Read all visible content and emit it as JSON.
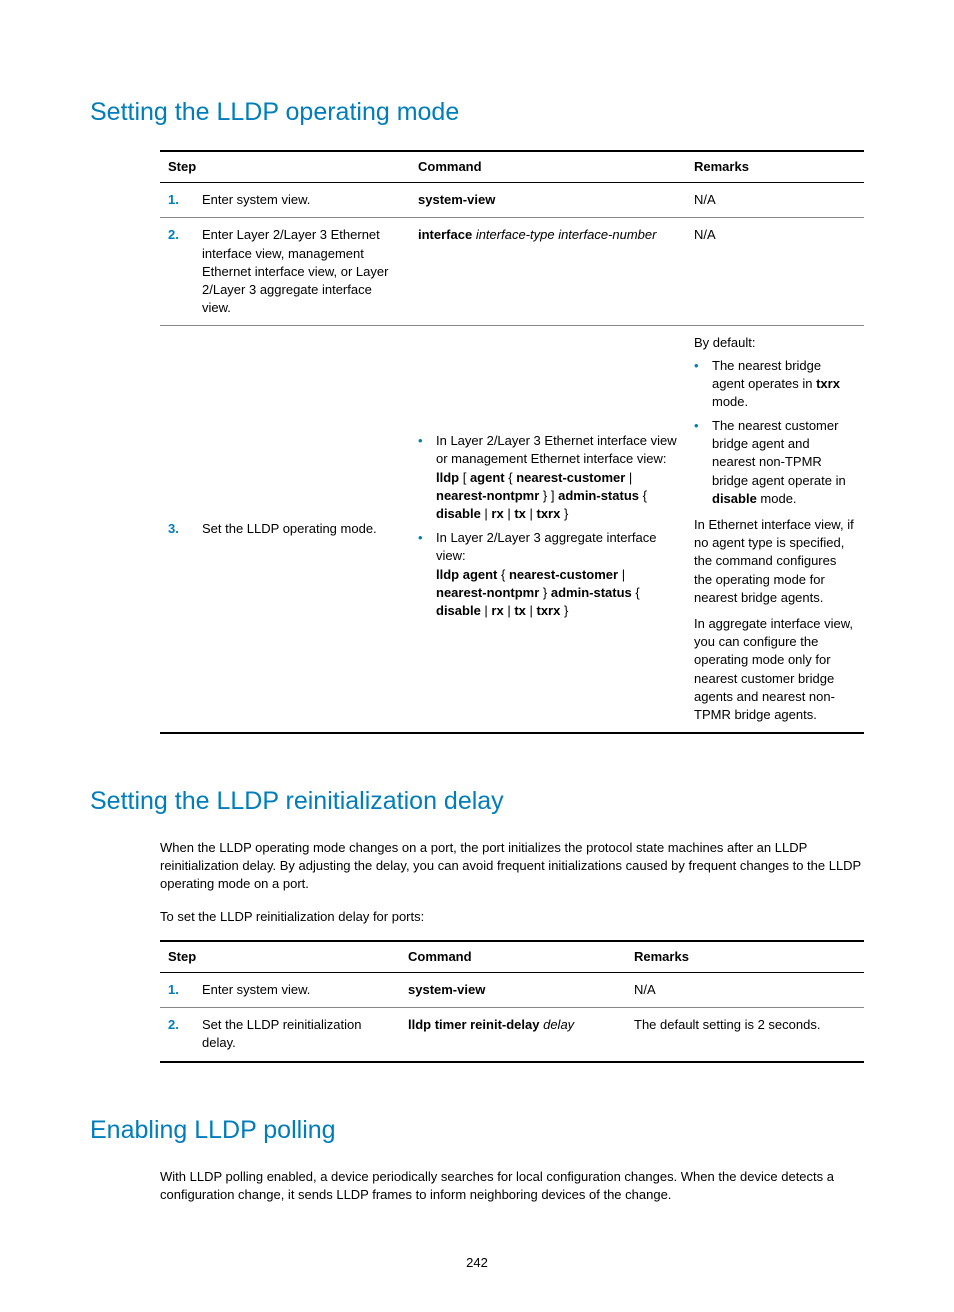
{
  "section1": {
    "heading": "Setting the LLDP operating mode",
    "headers": {
      "step": "Step",
      "command": "Command",
      "remarks": "Remarks"
    },
    "rows": {
      "r1": {
        "num": "1.",
        "desc": "Enter system view.",
        "cmd": "system-view",
        "rem": "N/A"
      },
      "r2": {
        "num": "2.",
        "desc": "Enter Layer 2/Layer 3 Ethernet interface view, management Ethernet interface view, or Layer 2/Layer 3 aggregate interface view.",
        "cmd_b": "interface",
        "cmd_i": " interface-type interface-number",
        "rem": "N/A"
      },
      "r3": {
        "num": "3.",
        "desc": "Set the LLDP operating mode.",
        "cmd_li1_intro": "In Layer 2/Layer 3 Ethernet interface view or management Ethernet interface view:",
        "cmd_li1_p1b": "lldp",
        "cmd_li1_p2": " [ ",
        "cmd_li1_p3b": "agent",
        "cmd_li1_p4": " { ",
        "cmd_li1_p5b": "nearest-customer",
        "cmd_li1_p6": " | ",
        "cmd_li1_p7b": "nearest-nontpmr",
        "cmd_li1_p8": " } ] ",
        "cmd_li1_p9b": "admin-status",
        "cmd_li1_p10": " { ",
        "cmd_li1_p11b": "disable",
        "cmd_li1_p12": " | ",
        "cmd_li1_p13b": "rx",
        "cmd_li1_p14": " | ",
        "cmd_li1_p15b": "tx",
        "cmd_li1_p16": " | ",
        "cmd_li1_p17b": "txrx",
        "cmd_li1_p18": " }",
        "cmd_li2_intro": "In Layer 2/Layer 3 aggregate interface view:",
        "cmd_li2_p1b": "lldp agent",
        "cmd_li2_p2": " { ",
        "cmd_li2_p3b": "nearest-customer",
        "cmd_li2_p4": " | ",
        "cmd_li2_p5b": "nearest-nontpmr",
        "cmd_li2_p6": " } ",
        "cmd_li2_p7b": "admin-status",
        "cmd_li2_p8": " { ",
        "cmd_li2_p9b": "disable",
        "cmd_li2_p10": " | ",
        "cmd_li2_p11b": "rx",
        "cmd_li2_p12": " | ",
        "cmd_li2_p13b": "tx",
        "cmd_li2_p14": " | ",
        "cmd_li2_p15b": "txrx",
        "cmd_li2_p16": " }",
        "rem_intro": "By default:",
        "rem_li1_a": "The nearest bridge agent operates in ",
        "rem_li1_b": "txrx",
        "rem_li1_c": " mode.",
        "rem_li2_a": "The nearest customer bridge agent and nearest non-TPMR bridge agent operate in ",
        "rem_li2_b": "disable",
        "rem_li2_c": " mode.",
        "rem_p1": "In Ethernet interface view, if no agent type is specified, the command configures the operating mode for nearest bridge agents.",
        "rem_p2": "In aggregate interface view, you can configure the operating mode only for nearest customer bridge agents and nearest non-TPMR bridge agents."
      }
    }
  },
  "section2": {
    "heading": "Setting the LLDP reinitialization delay",
    "para1": "When the LLDP operating mode changes on a port, the port initializes the protocol state machines after an LLDP reinitialization delay. By adjusting the delay, you can avoid frequent initializations caused by frequent changes to the LLDP operating mode on a port.",
    "para2": "To set the LLDP reinitialization delay for ports:",
    "headers": {
      "step": "Step",
      "command": "Command",
      "remarks": "Remarks"
    },
    "rows": {
      "r1": {
        "num": "1.",
        "desc": "Enter system view.",
        "cmd": "system-view",
        "rem": "N/A"
      },
      "r2": {
        "num": "2.",
        "desc": "Set the LLDP reinitialization delay.",
        "cmd_b": "lldp timer reinit-delay",
        "cmd_i": " delay",
        "rem": "The default setting is 2 seconds."
      }
    }
  },
  "section3": {
    "heading": "Enabling LLDP polling",
    "para1": "With LLDP polling enabled, a device periodically searches for local configuration changes. When the device detects a configuration change, it sends LLDP frames to inform neighboring devices of the change."
  },
  "page_num": "242"
}
